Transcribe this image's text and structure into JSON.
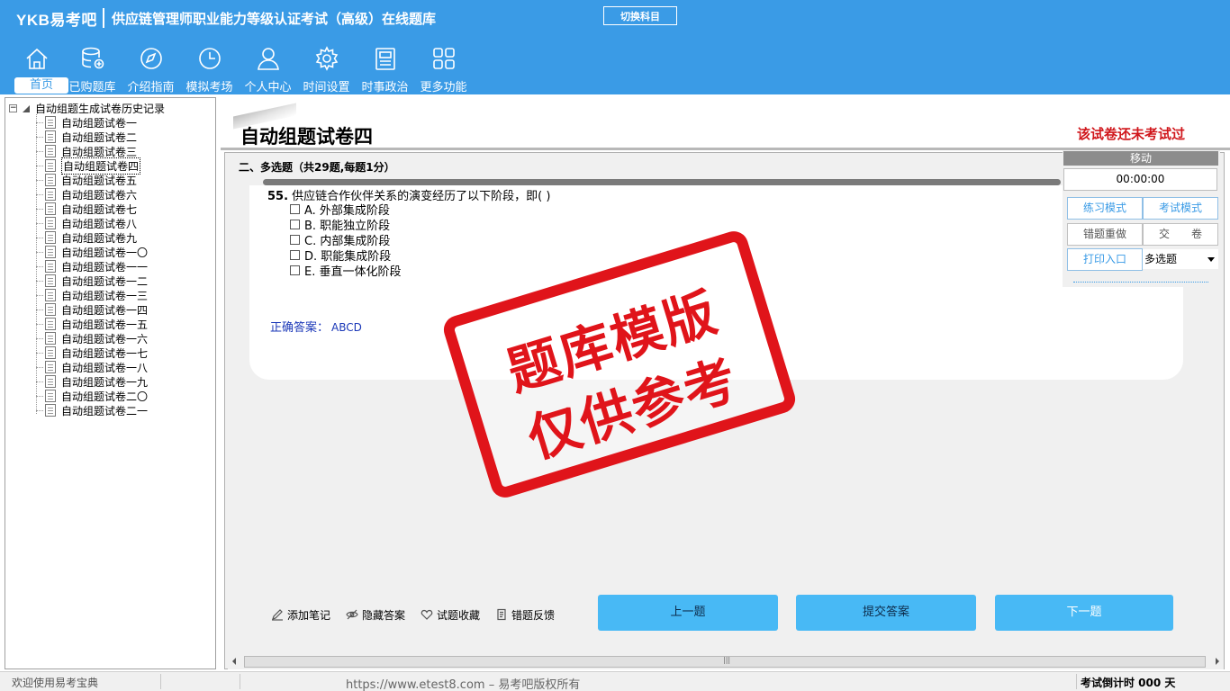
{
  "header": {
    "brand": "YKB易考吧",
    "title": "供应链管理师职业能力等级认证考试（高级）在线题库",
    "switch_subject": "切换科目"
  },
  "nav": [
    {
      "label": "首页",
      "icon": "home-icon",
      "active": true
    },
    {
      "label": "已购题库",
      "icon": "database-icon"
    },
    {
      "label": "介绍指南",
      "icon": "compass-icon"
    },
    {
      "label": "模拟考场",
      "icon": "clock-icon"
    },
    {
      "label": "个人中心",
      "icon": "user-icon"
    },
    {
      "label": "时间设置",
      "icon": "gear-icon"
    },
    {
      "label": "时事政治",
      "icon": "news-icon"
    },
    {
      "label": "更多功能",
      "icon": "grid-icon"
    }
  ],
  "tree": {
    "root": "自动组题生成试卷历史记录",
    "items": [
      "自动组题试卷一",
      "自动组题试卷二",
      "自动组题试卷三",
      "自动组题试卷四",
      "自动组题试卷五",
      "自动组题试卷六",
      "自动组题试卷七",
      "自动组题试卷八",
      "自动组题试卷九",
      "自动组题试卷一〇",
      "自动组题试卷一一",
      "自动组题试卷一二",
      "自动组题试卷一三",
      "自动组题试卷一四",
      "自动组题试卷一五",
      "自动组题试卷一六",
      "自动组题试卷一七",
      "自动组题试卷一八",
      "自动组题试卷一九",
      "自动组题试卷二〇",
      "自动组题试卷二一"
    ],
    "selected_index": 3
  },
  "paper": {
    "title": "自动组题试卷四",
    "status": "该试卷还未考试过",
    "section": "二、多选题（共29题,每题1分）"
  },
  "question": {
    "number": "55.",
    "text": "供应链合作伙伴关系的演变经历了以下阶段，即(  )",
    "options": [
      "A. 外部集成阶段",
      "B. 职能独立阶段",
      "C. 内部集成阶段",
      "D. 职能集成阶段",
      "E. 垂直一体化阶段"
    ],
    "answer_label": "正确答案：",
    "answer_value": "ABCD"
  },
  "control": {
    "move": "移动",
    "timer": "00:00:00",
    "practice_mode": "练习模式",
    "exam_mode": "考试模式",
    "redo_wrong": "错题重做",
    "submit_paper": "交　　卷",
    "print": "打印入口",
    "type_select": "多选题"
  },
  "tools": [
    {
      "label": "添加笔记",
      "icon": "pencil-icon"
    },
    {
      "label": "隐藏答案",
      "icon": "eye-icon"
    },
    {
      "label": "试题收藏",
      "icon": "heart-icon"
    },
    {
      "label": "错题反馈",
      "icon": "feedback-icon"
    }
  ],
  "actions": {
    "prev": "上一题",
    "submit": "提交答案",
    "next": "下一题"
  },
  "statusbar": {
    "welcome": "欢迎使用易考宝典",
    "url": "https://www.etest8.com – 易考吧版权所有",
    "countdown": "考试倒计时 000 天"
  },
  "watermark": {
    "line1": "题库模版",
    "line2": "仅供参考"
  },
  "colors": {
    "header_blue": "#3a9be6",
    "button_blue": "#48b9f5",
    "alert_red": "#d0161b",
    "answer_blue": "#1b38b8"
  }
}
